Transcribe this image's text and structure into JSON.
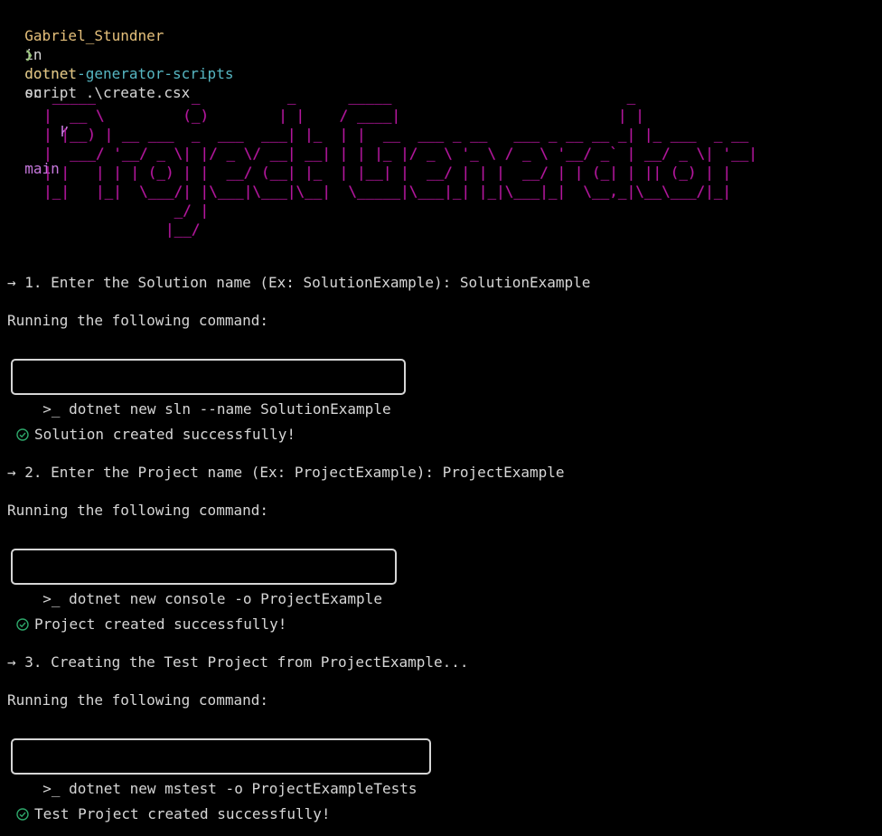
{
  "prompt": {
    "user": "Gabriel_Stundner",
    "in_word": "in",
    "repo": "dotnet-generator-scripts",
    "on_word": "on",
    "branch_icon": "git-branch-icon",
    "branch": "main",
    "arrow": "❯",
    "command_bin": "dotnet",
    "command_args": "script .\\create.csx"
  },
  "banner": {
    "ascii": "      _____           _          _      _____                           _\n     |  __ \\         (_)        | |    / ____|                         | |\n     | |__) | __ ___  _  ___  ___| |_  | |  __  ___ _ __   ___ _ __ __ _| |_ ___  _ __\n     |  ___/ '__/ _ \\| |/ _ \\/ __| __| | | |_ |/ _ \\ '_ \\ / _ \\ '__/ _` | __/ _ \\| '__|\n     | |   | | | (_) | |  __/ (__| |_  | |__| |  __/ | | |  __/ | | (_| | || (_) | |\n     |_|   |_|  \\___/| |\\___|\\___|\\__|  \\_____|\\___|_| |_|\\___|_|  \\__,_|\\__\\___/|_|\n                    _/ |\n                   |__/",
    "color": "#b5179e"
  },
  "steps": [
    {
      "prompt": "→ 1. Enter the Solution name (Ex: SolutionExample): SolutionExample",
      "running": "Running the following command:",
      "command": ">_ dotnet new sln --name SolutionExample",
      "success": "Solution created successfully!"
    },
    {
      "prompt": "→ 2. Enter the Project name (Ex: ProjectExample): ProjectExample",
      "running": "Running the following command:",
      "command": ">_ dotnet new console -o ProjectExample",
      "success": "Project created successfully!"
    },
    {
      "prompt": "→ 3. Creating the Test Project from ProjectExample...",
      "running": "Running the following command:",
      "command": ">_ dotnet new mstest -o ProjectExampleTests",
      "success": "Test Project created successfully!"
    }
  ],
  "colors": {
    "background": "#000000",
    "foreground": "#d6d6d6",
    "user": "#e5c07b",
    "repo": "#56b6c2",
    "branch": "#c678dd",
    "success_icon": "#2ea86b"
  }
}
